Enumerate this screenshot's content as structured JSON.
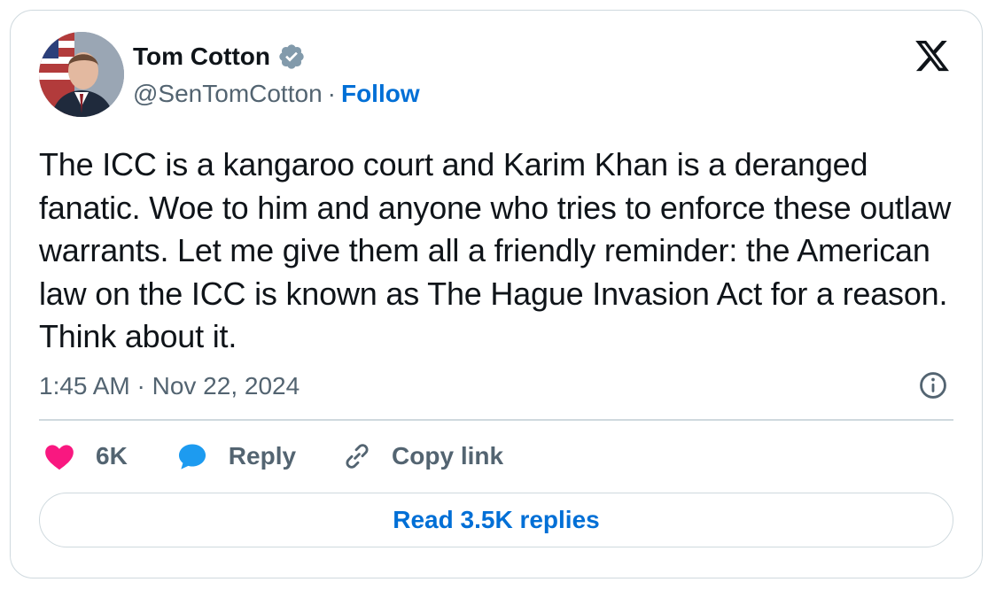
{
  "author": {
    "name": "Tom Cotton",
    "handle": "@SenTomCotton",
    "separator": "·",
    "follow_label": "Follow",
    "verified_icon": "verified-badge-icon",
    "avatar_icon": "profile-photo"
  },
  "brand": {
    "logo_icon": "x-logo-icon"
  },
  "tweet": {
    "text": "The ICC is a kangaroo court and Karim Khan is a deranged fanatic. Woe to him and anyone who tries to enforce these outlaw warrants. Let me give them all a friendly reminder: the American law on the ICC is known as The Hague Invasion Act for a reason. Think about it.",
    "timestamp": "1:45 AM · Nov 22, 2024"
  },
  "actions": {
    "like_count": "6K",
    "reply_label": "Reply",
    "copy_link_label": "Copy link"
  },
  "replies_button": {
    "label": "Read 3.5K replies"
  },
  "colors": {
    "accent": "#006fd6",
    "like": "#f91880",
    "reply_bubble": "#1d9bf0",
    "muted_text": "#536471",
    "border": "#cfd9de"
  }
}
